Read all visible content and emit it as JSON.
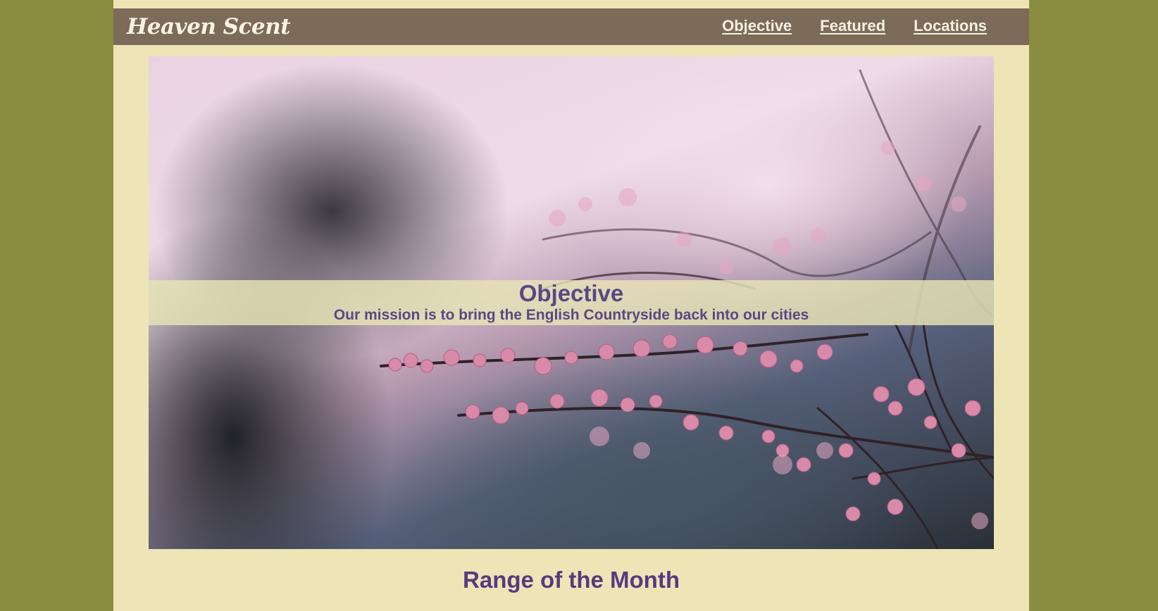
{
  "site": {
    "brand": "Heaven Scent"
  },
  "nav": {
    "items": [
      {
        "label": "Objective"
      },
      {
        "label": "Featured"
      },
      {
        "label": "Locations"
      }
    ]
  },
  "hero": {
    "image": "blossom-branch-image",
    "title": "Objective",
    "subtitle": "Our mission is to bring the English Countryside back into our cities"
  },
  "sections": {
    "range_title": "Range of the Month"
  },
  "colors": {
    "background": "#8a8c40",
    "page": "#ede5b6",
    "navbar": "#7c6b58",
    "nav_text": "#f7f1e3",
    "heading": "#5b4784"
  }
}
